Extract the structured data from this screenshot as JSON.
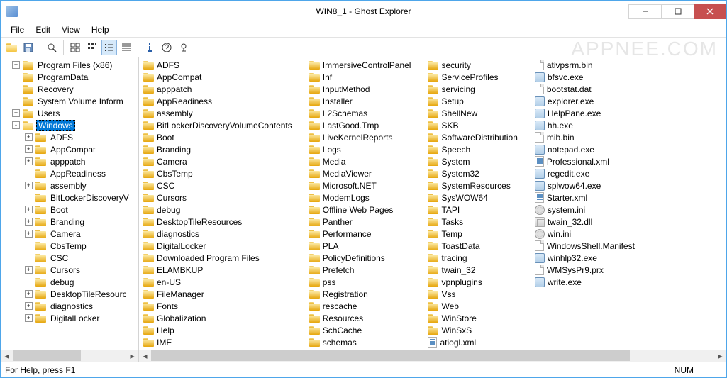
{
  "title": "WIN8_1 - Ghost Explorer",
  "menus": [
    "File",
    "Edit",
    "View",
    "Help"
  ],
  "toolbar_names": [
    "open",
    "save",
    "zoom",
    "view-large",
    "view-small",
    "view-list",
    "view-detail",
    "info",
    "help",
    "update"
  ],
  "watermark": "APPNEE.COM",
  "tree": [
    {
      "d": 0,
      "exp": "+",
      "label": "Program Files (x86)"
    },
    {
      "d": 0,
      "exp": "",
      "label": "ProgramData"
    },
    {
      "d": 0,
      "exp": "",
      "label": "Recovery"
    },
    {
      "d": 0,
      "exp": "",
      "label": "System Volume Inform"
    },
    {
      "d": 0,
      "exp": "+",
      "label": "Users"
    },
    {
      "d": 0,
      "exp": "-",
      "label": "Windows",
      "sel": true,
      "open": true
    },
    {
      "d": 1,
      "exp": "+",
      "label": "ADFS"
    },
    {
      "d": 1,
      "exp": "+",
      "label": "AppCompat"
    },
    {
      "d": 1,
      "exp": "+",
      "label": "apppatch"
    },
    {
      "d": 1,
      "exp": "",
      "label": "AppReadiness"
    },
    {
      "d": 1,
      "exp": "+",
      "label": "assembly"
    },
    {
      "d": 1,
      "exp": "",
      "label": "BitLockerDiscoveryV"
    },
    {
      "d": 1,
      "exp": "+",
      "label": "Boot"
    },
    {
      "d": 1,
      "exp": "+",
      "label": "Branding"
    },
    {
      "d": 1,
      "exp": "+",
      "label": "Camera"
    },
    {
      "d": 1,
      "exp": "",
      "label": "CbsTemp"
    },
    {
      "d": 1,
      "exp": "",
      "label": "CSC"
    },
    {
      "d": 1,
      "exp": "+",
      "label": "Cursors"
    },
    {
      "d": 1,
      "exp": "",
      "label": "debug"
    },
    {
      "d": 1,
      "exp": "+",
      "label": "DesktopTileResourc"
    },
    {
      "d": 1,
      "exp": "+",
      "label": "diagnostics"
    },
    {
      "d": 1,
      "exp": "+",
      "label": "DigitalLocker"
    }
  ],
  "list": [
    {
      "n": "ADFS",
      "t": "folder"
    },
    {
      "n": "AppCompat",
      "t": "folder"
    },
    {
      "n": "apppatch",
      "t": "folder"
    },
    {
      "n": "AppReadiness",
      "t": "folder"
    },
    {
      "n": "assembly",
      "t": "folder"
    },
    {
      "n": "BitLockerDiscoveryVolumeContents",
      "t": "folder"
    },
    {
      "n": "Boot",
      "t": "folder"
    },
    {
      "n": "Branding",
      "t": "folder"
    },
    {
      "n": "Camera",
      "t": "folder"
    },
    {
      "n": "CbsTemp",
      "t": "folder"
    },
    {
      "n": "CSC",
      "t": "folder"
    },
    {
      "n": "Cursors",
      "t": "folder"
    },
    {
      "n": "debug",
      "t": "folder"
    },
    {
      "n": "DesktopTileResources",
      "t": "folder"
    },
    {
      "n": "diagnostics",
      "t": "folder"
    },
    {
      "n": "DigitalLocker",
      "t": "folder"
    },
    {
      "n": "Downloaded Program Files",
      "t": "folder"
    },
    {
      "n": "ELAMBKUP",
      "t": "folder"
    },
    {
      "n": "en-US",
      "t": "folder"
    },
    {
      "n": "FileManager",
      "t": "folder"
    },
    {
      "n": "Fonts",
      "t": "folder"
    },
    {
      "n": "Globalization",
      "t": "folder"
    },
    {
      "n": "Help",
      "t": "folder"
    },
    {
      "n": "IME",
      "t": "folder"
    },
    {
      "n": "ImmersiveControlPanel",
      "t": "folder"
    },
    {
      "n": "Inf",
      "t": "folder"
    },
    {
      "n": "InputMethod",
      "t": "folder"
    },
    {
      "n": "Installer",
      "t": "folder"
    },
    {
      "n": "L2Schemas",
      "t": "folder"
    },
    {
      "n": "LastGood.Tmp",
      "t": "folder"
    },
    {
      "n": "LiveKernelReports",
      "t": "folder"
    },
    {
      "n": "Logs",
      "t": "folder"
    },
    {
      "n": "Media",
      "t": "folder"
    },
    {
      "n": "MediaViewer",
      "t": "folder"
    },
    {
      "n": "Microsoft.NET",
      "t": "folder"
    },
    {
      "n": "ModemLogs",
      "t": "folder"
    },
    {
      "n": "Offline Web Pages",
      "t": "folder"
    },
    {
      "n": "Panther",
      "t": "folder"
    },
    {
      "n": "Performance",
      "t": "folder"
    },
    {
      "n": "PLA",
      "t": "folder"
    },
    {
      "n": "PolicyDefinitions",
      "t": "folder"
    },
    {
      "n": "Prefetch",
      "t": "folder"
    },
    {
      "n": "pss",
      "t": "folder"
    },
    {
      "n": "Registration",
      "t": "folder"
    },
    {
      "n": "rescache",
      "t": "folder"
    },
    {
      "n": "Resources",
      "t": "folder"
    },
    {
      "n": "SchCache",
      "t": "folder"
    },
    {
      "n": "schemas",
      "t": "folder"
    },
    {
      "n": "security",
      "t": "folder"
    },
    {
      "n": "ServiceProfiles",
      "t": "folder"
    },
    {
      "n": "servicing",
      "t": "folder"
    },
    {
      "n": "Setup",
      "t": "folder"
    },
    {
      "n": "ShellNew",
      "t": "folder"
    },
    {
      "n": "SKB",
      "t": "folder"
    },
    {
      "n": "SoftwareDistribution",
      "t": "folder"
    },
    {
      "n": "Speech",
      "t": "folder"
    },
    {
      "n": "System",
      "t": "folder"
    },
    {
      "n": "System32",
      "t": "folder"
    },
    {
      "n": "SystemResources",
      "t": "folder"
    },
    {
      "n": "SysWOW64",
      "t": "folder"
    },
    {
      "n": "TAPI",
      "t": "folder"
    },
    {
      "n": "Tasks",
      "t": "folder"
    },
    {
      "n": "Temp",
      "t": "folder"
    },
    {
      "n": "ToastData",
      "t": "folder"
    },
    {
      "n": "tracing",
      "t": "folder"
    },
    {
      "n": "twain_32",
      "t": "folder"
    },
    {
      "n": "vpnplugins",
      "t": "folder"
    },
    {
      "n": "Vss",
      "t": "folder"
    },
    {
      "n": "Web",
      "t": "folder"
    },
    {
      "n": "WinStore",
      "t": "folder"
    },
    {
      "n": "WinSxS",
      "t": "folder"
    },
    {
      "n": "atiogl.xml",
      "t": "xml"
    },
    {
      "n": "ativpsrm.bin",
      "t": "file"
    },
    {
      "n": "bfsvc.exe",
      "t": "exe"
    },
    {
      "n": "bootstat.dat",
      "t": "file"
    },
    {
      "n": "explorer.exe",
      "t": "exe"
    },
    {
      "n": "HelpPane.exe",
      "t": "exe"
    },
    {
      "n": "hh.exe",
      "t": "exe"
    },
    {
      "n": "mib.bin",
      "t": "file"
    },
    {
      "n": "notepad.exe",
      "t": "exe"
    },
    {
      "n": "Professional.xml",
      "t": "xml"
    },
    {
      "n": "regedit.exe",
      "t": "exe"
    },
    {
      "n": "splwow64.exe",
      "t": "exe"
    },
    {
      "n": "Starter.xml",
      "t": "xml"
    },
    {
      "n": "system.ini",
      "t": "ini"
    },
    {
      "n": "twain_32.dll",
      "t": "dll"
    },
    {
      "n": "win.ini",
      "t": "ini"
    },
    {
      "n": "WindowsShell.Manifest",
      "t": "file"
    },
    {
      "n": "winhlp32.exe",
      "t": "exe"
    },
    {
      "n": "WMSysPr9.prx",
      "t": "file"
    },
    {
      "n": "write.exe",
      "t": "exe"
    }
  ],
  "status": {
    "hint": "For Help, press F1",
    "num": "NUM"
  }
}
